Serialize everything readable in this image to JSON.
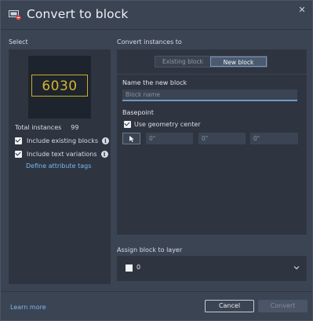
{
  "window": {
    "title": "Convert to block",
    "close_glyph": "✕",
    "title_icon": "convert-block-icon"
  },
  "left": {
    "section_label": "Select",
    "preview_text": "6030",
    "total_label": "Total instances",
    "total_count": "99",
    "checkboxes": [
      {
        "label": "Include existing blocks",
        "checked": true
      },
      {
        "label": "Include text variations",
        "checked": true
      }
    ],
    "define_link": "Define attribute tags"
  },
  "right": {
    "section_label": "Convert instances to",
    "tabs": [
      {
        "label": "Existing block",
        "active": false
      },
      {
        "label": "New block",
        "active": true
      }
    ],
    "name_label": "Name the new block",
    "name_placeholder": "Block name",
    "name_value": "",
    "basepoint_label": "Basepoint",
    "use_center_label": "Use geometry center",
    "use_center_checked": true,
    "coords": [
      "0\"",
      "0\"",
      "0\""
    ]
  },
  "layer": {
    "section_label": "Assign block to layer",
    "selected_layer": "0",
    "swatch_color": "#f2f4f7"
  },
  "footer": {
    "learn_more": "Learn more",
    "cancel_label": "Cancel",
    "convert_label": "Convert",
    "convert_enabled": false
  },
  "colors": {
    "background": "#3b4453",
    "panel": "#2e3541",
    "accent_link": "#7ab8ee",
    "preview_yellow": "#d4b52f"
  }
}
